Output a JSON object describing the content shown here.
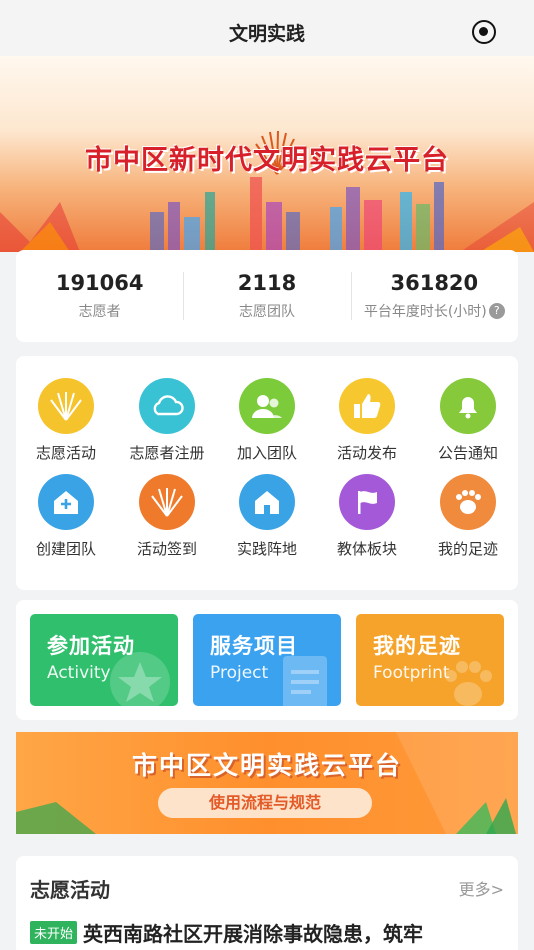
{
  "nav": {
    "title": "文明实践"
  },
  "banner": {
    "title": "市中区新时代文明实践云平台"
  },
  "stats": [
    {
      "value": "191064",
      "label": "志愿者"
    },
    {
      "value": "2118",
      "label": "志愿团队"
    },
    {
      "value": "361820",
      "label": "平台年度时长(小时)"
    }
  ],
  "grid": [
    {
      "label": "志愿活动",
      "icon": "fan-logo-icon",
      "color": "#f5c32b"
    },
    {
      "label": "志愿者注册",
      "icon": "cloud-icon",
      "color": "#39c2d4"
    },
    {
      "label": "加入团队",
      "icon": "users-icon",
      "color": "#7ccb3a"
    },
    {
      "label": "活动发布",
      "icon": "thumbs-up-icon",
      "color": "#f7c730"
    },
    {
      "label": "公告通知",
      "icon": "bell-icon",
      "color": "#86c93b"
    },
    {
      "label": "创建团队",
      "icon": "house-plus-icon",
      "color": "#3aa3e6"
    },
    {
      "label": "活动签到",
      "icon": "fan-logo-icon",
      "color": "#f07a2c"
    },
    {
      "label": "实践阵地",
      "icon": "house-icon",
      "color": "#3aa3e6"
    },
    {
      "label": "教体板块",
      "icon": "flag-icon",
      "color": "#a45ad8"
    },
    {
      "label": "我的足迹",
      "icon": "footprint-icon",
      "color": "#f08a3c"
    }
  ],
  "quick": [
    {
      "title": "参加活动",
      "sub": "Activity",
      "color": "#2fbf6d",
      "icon": "star-icon"
    },
    {
      "title": "服务项目",
      "sub": "Project",
      "color": "#3ba2f0",
      "icon": "document-icon"
    },
    {
      "title": "我的足迹",
      "sub": "Footprint",
      "color": "#f5a32a",
      "icon": "paw-icon"
    }
  ],
  "promo": {
    "title": "市中区文明实践云平台",
    "button": "使用流程与规范"
  },
  "section": {
    "title": "志愿活动",
    "more": "更多>",
    "first": {
      "badge": "未开始",
      "title": "英西南路社区开展消除事故隐患，筑牢"
    }
  }
}
